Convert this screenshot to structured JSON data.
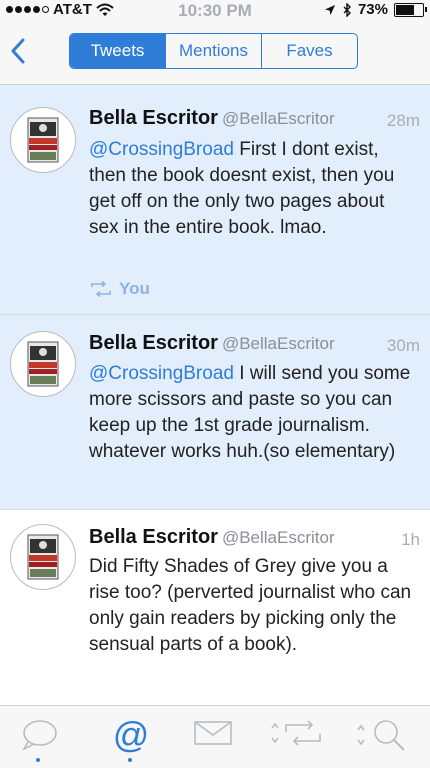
{
  "status_bar": {
    "carrier": "AT&T",
    "time": "10:30 PM",
    "battery": "73%",
    "battery_level": 0.73
  },
  "nav": {
    "back_icon": "back-chevron-icon",
    "tabs": [
      "Tweets",
      "Mentions",
      "Faves"
    ],
    "selected_tab": "Tweets"
  },
  "tweets": [
    {
      "name": "Bella Escritor",
      "handle": "@BellaEscritor",
      "time": "28m",
      "mention": "@CrossingBroad",
      "body": " First I dont exist, then the book doesnt exist, then you get off on the only two pages about sex in the entire book.  lmao.",
      "retweet_label": "You",
      "highlighted": true
    },
    {
      "name": "Bella Escritor",
      "handle": "@BellaEscritor",
      "time": "30m",
      "mention": "@CrossingBroad",
      "body": " I will send you some more scissors and paste so you can keep up the 1st grade journalism.  whatever works huh.(so elementary)",
      "highlighted": true
    },
    {
      "name": "Bella Escritor",
      "handle": "@BellaEscritor",
      "time": "1h",
      "mention": "",
      "body": "Did Fifty Shades of Grey give you a rise too? (perverted journalist who can only gain readers by picking only the sensual parts of a book).",
      "highlighted": false
    }
  ],
  "tab_bar": {
    "icons": [
      "speech-bubble-icon",
      "at-sign-icon",
      "envelope-icon",
      "retweet-icon",
      "search-icon"
    ],
    "at_symbol": "@",
    "active": "at-sign-icon",
    "colors": {
      "accent": "#2f7dd9",
      "inactive": "#b8bcc2"
    }
  }
}
